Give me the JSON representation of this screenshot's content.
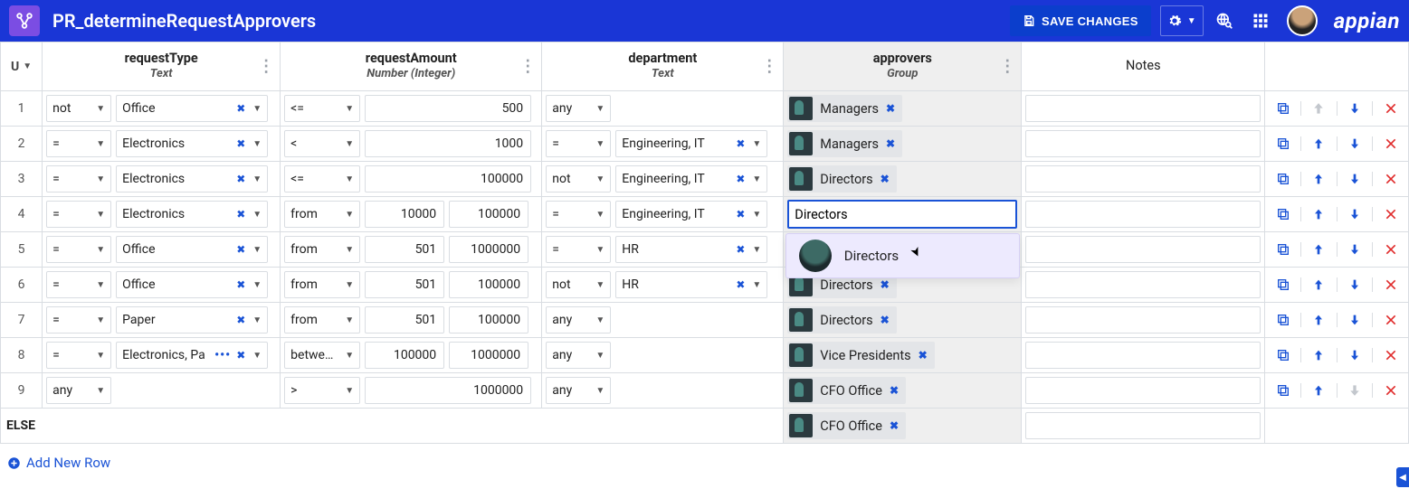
{
  "brand": "appian",
  "header": {
    "title": "PR_determineRequestApprovers",
    "save_label": "SAVE CHANGES"
  },
  "columns": {
    "u_label": "U",
    "requestType": {
      "name": "requestType",
      "type": "Text"
    },
    "requestAmount": {
      "name": "requestAmount",
      "type": "Number (Integer)"
    },
    "department": {
      "name": "department",
      "type": "Text"
    },
    "approvers": {
      "name": "approvers",
      "type": "Group"
    },
    "notes": {
      "name": "Notes"
    }
  },
  "chart_data": {
    "type": "table",
    "rows": [
      {
        "n": 1,
        "rt_op": "not",
        "rt_val": "Office",
        "ra_op": "<=",
        "ra_v1": "",
        "ra_v2": "500",
        "dept_op": "any",
        "dept_val": "",
        "approver": "Managers",
        "up_disabled": true,
        "down_disabled": false
      },
      {
        "n": 2,
        "rt_op": "=",
        "rt_val": "Electronics",
        "ra_op": "<",
        "ra_v1": "",
        "ra_v2": "1000",
        "dept_op": "=",
        "dept_val": "Engineering, IT",
        "approver": "Managers",
        "up_disabled": false,
        "down_disabled": false
      },
      {
        "n": 3,
        "rt_op": "=",
        "rt_val": "Electronics",
        "ra_op": "<=",
        "ra_v1": "",
        "ra_v2": "100000",
        "dept_op": "not",
        "dept_val": "Engineering, IT",
        "approver": "Directors",
        "up_disabled": false,
        "down_disabled": false
      },
      {
        "n": 4,
        "rt_op": "=",
        "rt_val": "Electronics",
        "ra_op": "from",
        "ra_v1": "10000",
        "ra_v2": "100000",
        "dept_op": "=",
        "dept_val": "Engineering, IT",
        "approver_search": "Directors",
        "up_disabled": false,
        "down_disabled": false
      },
      {
        "n": 5,
        "rt_op": "=",
        "rt_val": "Office",
        "ra_op": "from",
        "ra_v1": "501",
        "ra_v2": "1000000",
        "dept_op": "=",
        "dept_val": "HR",
        "up_disabled": false,
        "down_disabled": false
      },
      {
        "n": 6,
        "rt_op": "=",
        "rt_val": "Office",
        "ra_op": "from",
        "ra_v1": "501",
        "ra_v2": "100000",
        "dept_op": "not",
        "dept_val": "HR",
        "approver": "Directors",
        "up_disabled": false,
        "down_disabled": false
      },
      {
        "n": 7,
        "rt_op": "=",
        "rt_val": "Paper",
        "ra_op": "from",
        "ra_v1": "501",
        "ra_v2": "100000",
        "dept_op": "any",
        "dept_val": "",
        "approver": "Directors",
        "up_disabled": false,
        "down_disabled": false
      },
      {
        "n": 8,
        "rt_op": "=",
        "rt_val": "Electronics, Pa",
        "rt_more": true,
        "ra_op": "betwe…",
        "ra_v1": "100000",
        "ra_v2": "1000000",
        "dept_op": "any",
        "dept_val": "",
        "approver": "Vice Presidents",
        "up_disabled": false,
        "down_disabled": false
      },
      {
        "n": 9,
        "rt_op": "any",
        "rt_val": "",
        "ra_op": ">",
        "ra_v1": "",
        "ra_v2": "1000000",
        "dept_op": "any",
        "dept_val": "",
        "approver": "CFO Office",
        "up_disabled": false,
        "down_disabled": true
      }
    ],
    "else_row": {
      "label": "ELSE",
      "approver": "CFO Office"
    },
    "autocomplete": {
      "for_row": 4,
      "option": "Directors"
    }
  },
  "add_row_label": "Add New Row"
}
